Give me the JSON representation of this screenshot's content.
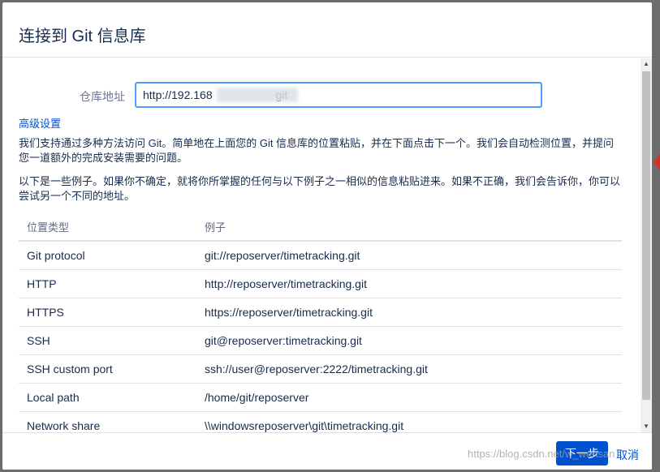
{
  "dialog": {
    "title": "连接到 Git 信息库",
    "repo_url": {
      "label": "仓库地址",
      "value": "http://192.168                    git"
    },
    "advanced_link": "高级设置",
    "description_1": "我们支持通过多种方法访问 Git。简单地在上面您的 Git 信息库的位置粘贴，并在下面点击下一个。我们会自动检测位置，并提问您一道额外的完成安装需要的问题。",
    "description_2": "以下是一些例子。如果你不确定，就将你所掌握的任何与以下例子之一相似的信息粘贴进来。如果不正确，我们会告诉你，你可以尝试另一个不同的地址。",
    "table": {
      "headers": [
        "位置类型",
        "例子"
      ],
      "rows": [
        [
          "Git protocol",
          "git://reposerver/timetracking.git"
        ],
        [
          "HTTP",
          "http://reposerver/timetracking.git"
        ],
        [
          "HTTPS",
          "https://reposerver/timetracking.git"
        ],
        [
          "SSH",
          "git@reposerver:timetracking.git"
        ],
        [
          "SSH custom port",
          "ssh://user@reposerver:2222/timetracking.git"
        ],
        [
          "Local path",
          "/home/git/reposerver"
        ],
        [
          "Network share",
          "\\\\windowsreposerver\\git\\timetracking.git"
        ]
      ]
    },
    "footer": {
      "next_label": "下一步",
      "cancel_label": "取消"
    }
  },
  "watermark": "https://blog.csdn.net/w_wensan",
  "icons": {
    "scroll_up": "scroll-up-arrow-icon",
    "scroll_down": "scroll-down-arrow-icon"
  },
  "colors": {
    "primary": "#0052cc",
    "focus_border": "#4c9aff",
    "overlay": "#6d6d6d"
  }
}
